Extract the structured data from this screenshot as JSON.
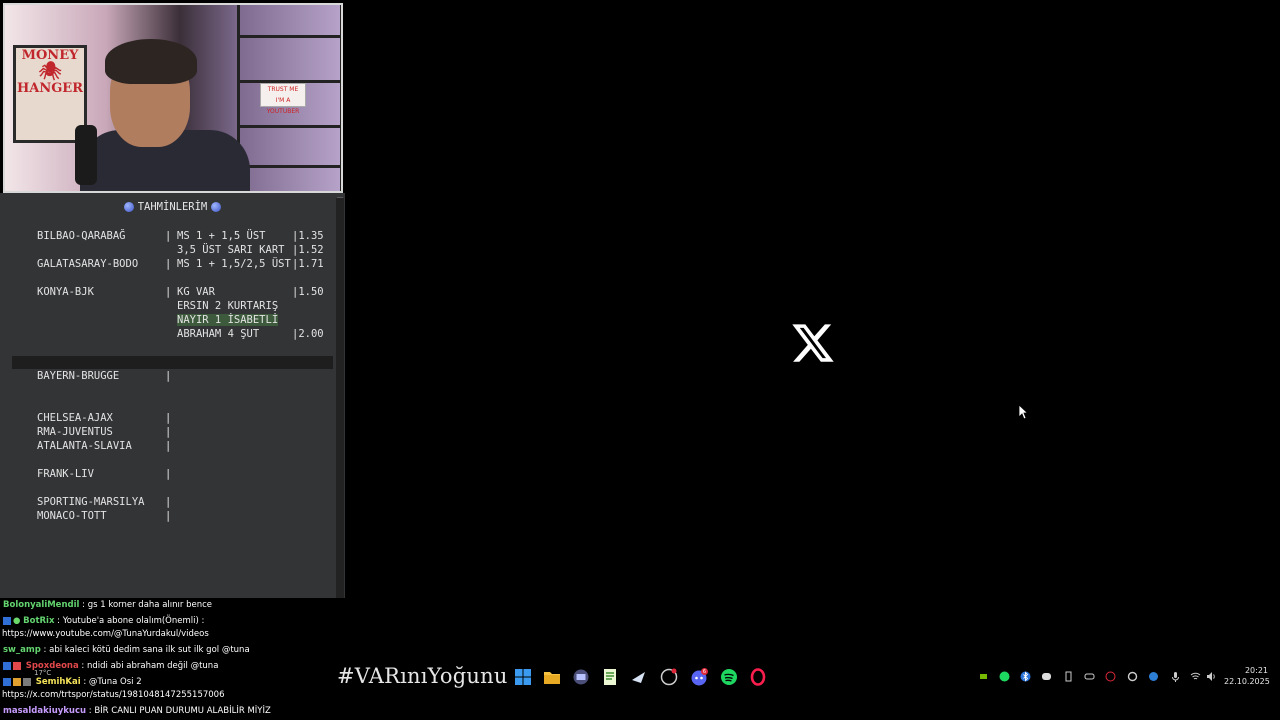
{
  "panel": {
    "title": "TAHMİNLERİM",
    "picks": [
      {
        "match": "BILBAO-QARABAĞ",
        "bet": "MS 1 + 1,5 ÜST",
        "odd": "|1.35"
      },
      {
        "match": "",
        "bet": "3,5 ÜST SARI KART",
        "odd": "|1.52"
      },
      {
        "match": "GALATASARAY-BODO",
        "bet": "MS 1 + 1,5/2,5 ÜST",
        "odd": "|1.71"
      },
      {
        "match": "KONYA-BJK",
        "bet": "KG VAR",
        "odd": "|1.50"
      },
      {
        "match": "",
        "bet": "ERSIN 2 KURTARIŞ",
        "odd": ""
      },
      {
        "match": "",
        "bet": "NAYIR 1 İSABETLİ",
        "odd": ""
      },
      {
        "match": "",
        "bet": "ABRAHAM 4 ŞUT",
        "odd": "|2.00"
      }
    ],
    "fixtures": [
      "BAYERN-BRUGGE",
      "CHELSEA-AJAX",
      "RMA-JUVENTUS",
      "ATALANTA-SLAVIA",
      "FRANK-LIV",
      "SPORTING-MARSILYA",
      "MONACO-TOTT"
    ]
  },
  "chat": [
    {
      "user": "BolonyaliMendil",
      "msg": ": gs 1 korner daha alınır bence"
    },
    {
      "user": "BotRix",
      "msg": ": Youtube'a abone olalım(Önemli) :"
    },
    {
      "user": "",
      "msg": "https://www.youtube.com/@TunaYurdakul/videos"
    },
    {
      "user": "sw_amp",
      "msg": ": abi kaleci kötü dedim sana ilk sut ilk gol @tuna"
    },
    {
      "user": "Spoxdeona",
      "msg": ": ndidi abi abraham değil @tuna"
    },
    {
      "user": "SemihKai",
      "msg": ": @Tuna Osi 2"
    },
    {
      "user": "",
      "msg": "https://x.com/trtspor/status/1981048147255157006"
    },
    {
      "user": "masaldakiuykucu",
      "msg": ": BİR CANLI PUAN DURUMU ALABİLİR MİYİZ"
    }
  ],
  "webcam": {
    "poster": [
      "MONEY",
      "HANGER"
    ],
    "sign": [
      "TRUST ME",
      "I'M A YOUTUBER"
    ]
  },
  "taskbar": {
    "brand": "#VARınıYoğunu",
    "discord_badge": "6",
    "temp": "17°C"
  },
  "clock": {
    "time": "20:21",
    "date": "22.10.2025"
  }
}
